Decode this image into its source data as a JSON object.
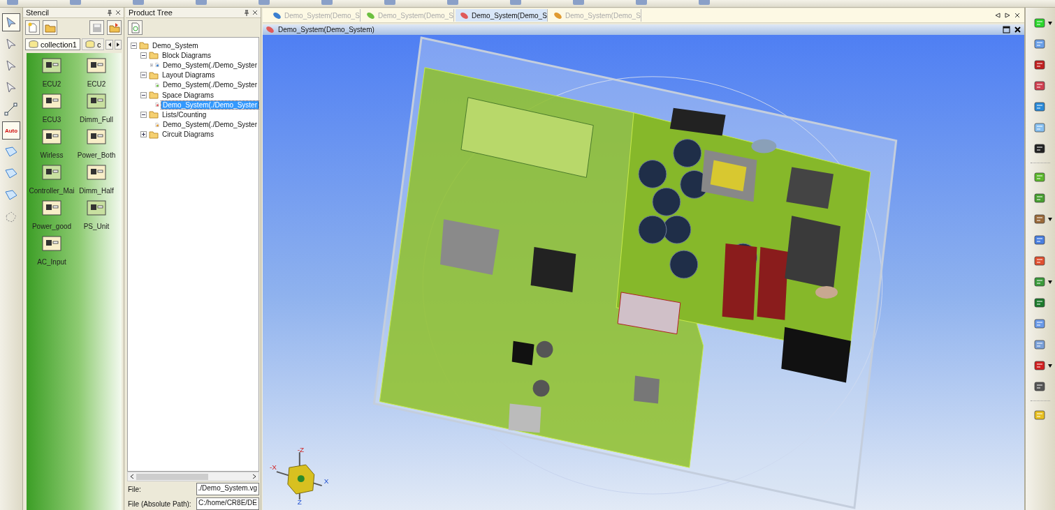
{
  "left_tools": [
    {
      "kind": "select",
      "selected": true
    },
    {
      "kind": "pointer",
      "selected": false
    },
    {
      "kind": "multi",
      "selected": false
    },
    {
      "kind": "frame",
      "selected": false
    },
    {
      "kind": "connect",
      "selected": false
    },
    {
      "kind": "auto",
      "label": "Auto",
      "selected": true
    },
    {
      "kind": "shape",
      "selected": false
    },
    {
      "kind": "points",
      "selected": false
    },
    {
      "kind": "link",
      "selected": false
    },
    {
      "kind": "dots",
      "selected": false
    }
  ],
  "stencil": {
    "title": "Stencil",
    "tabs": [
      {
        "label": "collection1",
        "selected": true
      },
      {
        "label": "c",
        "selected": false
      }
    ],
    "items": [
      {
        "label": "ECU2"
      },
      {
        "label": "ECU2"
      },
      {
        "label": "ECU3"
      },
      {
        "label": "Dimm_Full"
      },
      {
        "label": "Wirless"
      },
      {
        "label": "Power_Both"
      },
      {
        "label": "Controller_Mai"
      },
      {
        "label": "Dimm_Half"
      },
      {
        "label": "Power_good"
      },
      {
        "label": "PS_Unit"
      },
      {
        "label": "AC_Input"
      }
    ]
  },
  "product_tree": {
    "title": "Product Tree",
    "nodes": [
      {
        "label": "Demo_System",
        "kind": "folder",
        "expanded": true,
        "selected": false,
        "children": [
          {
            "label": "Block Diagrams",
            "kind": "folder",
            "expanded": true,
            "selected": false,
            "children": [
              {
                "label": "Demo_System(./Demo_Syster",
                "kind": "block",
                "expanded": false,
                "selected": false
              }
            ]
          },
          {
            "label": "Layout Diagrams",
            "kind": "folder",
            "expanded": true,
            "selected": false,
            "children": [
              {
                "label": "Demo_System(./Demo_Syster",
                "kind": "layout",
                "selected": false
              }
            ]
          },
          {
            "label": "Space Diagrams",
            "kind": "folder",
            "expanded": true,
            "selected": false,
            "children": [
              {
                "label": "Demo_System(./Demo_Syster",
                "kind": "space",
                "selected": true
              }
            ]
          },
          {
            "label": "Lists/Counting",
            "kind": "folder",
            "expanded": true,
            "selected": false,
            "children": [
              {
                "label": "Demo_System(./Demo_Syster",
                "kind": "list",
                "selected": false
              }
            ]
          },
          {
            "label": "Circuit Diagrams",
            "kind": "folder",
            "expanded": false,
            "selected": false
          }
        ]
      }
    ],
    "fields": [
      {
        "label": "File:",
        "value": "./Demo_System.vg"
      },
      {
        "label": "File (Absolute Path):",
        "value": "C:/home/CR8E/DE"
      }
    ]
  },
  "doc_tabs": [
    {
      "label": "Demo_System(Demo_S",
      "color": "#3a7fd0",
      "selected": false
    },
    {
      "label": "Demo_System(Demo_S",
      "color": "#6cc040",
      "selected": false
    },
    {
      "label": "Demo_System(Demo_S",
      "color": "#e05a5a",
      "selected": true
    },
    {
      "label": "Demo_System(Demo_S",
      "color": "#e09a30",
      "selected": false
    }
  ],
  "viewport": {
    "title": "Demo_System(Demo_System)",
    "axis_labels": [
      "-Z",
      "X",
      "-X",
      "Z"
    ]
  },
  "right_tools": [
    {
      "kind": "cube",
      "has_menu": true
    },
    {
      "kind": "rotate-boxes",
      "has_menu": false
    },
    {
      "kind": "ball-red",
      "has_menu": false
    },
    {
      "kind": "ball-arrow",
      "has_menu": false
    },
    {
      "kind": "orbit",
      "has_menu": false
    },
    {
      "kind": "zoom",
      "has_menu": false
    },
    {
      "kind": "pan",
      "has_menu": false
    },
    {
      "kind": "sep"
    },
    {
      "kind": "l-shape",
      "has_menu": false
    },
    {
      "kind": "l-arrow",
      "has_menu": false
    },
    {
      "kind": "wood",
      "has_menu": true
    },
    {
      "kind": "split",
      "has_menu": false
    },
    {
      "kind": "lift",
      "has_menu": false
    },
    {
      "kind": "place",
      "has_menu": true
    },
    {
      "kind": "green-block",
      "has_menu": false
    },
    {
      "kind": "xyz",
      "has_menu": false
    },
    {
      "kind": "origin",
      "has_menu": false
    },
    {
      "kind": "axes",
      "has_menu": true
    },
    {
      "kind": "hand",
      "has_menu": false
    },
    {
      "kind": "sep"
    },
    {
      "kind": "light",
      "has_menu": false
    }
  ]
}
